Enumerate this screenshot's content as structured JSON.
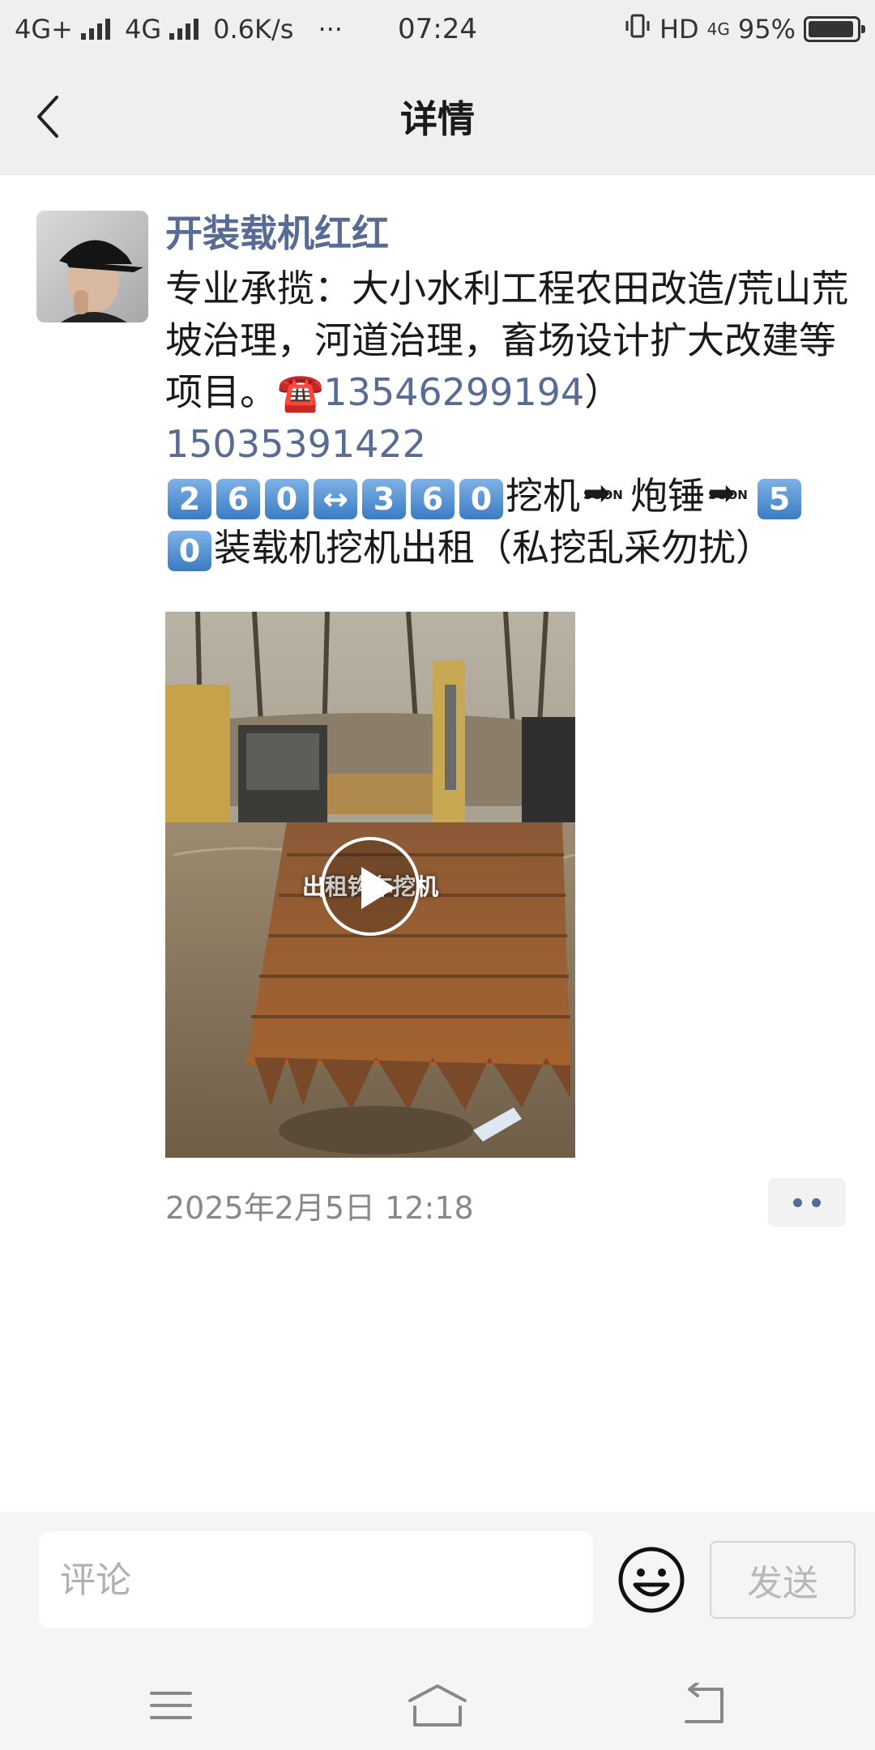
{
  "status_bar": {
    "network_left": "4G+",
    "network_mid": "4G",
    "speed": "0.6K/s",
    "dots": "···",
    "time": "07:24",
    "hd": "HD",
    "net_right": "4G",
    "battery": "95%",
    "battery_level": 0.95
  },
  "header": {
    "title": "详情",
    "back_icon": "chevron-left-icon"
  },
  "post": {
    "author": "开装载机红红",
    "text_line1": "专业承揽：大小水利工程农田改造/荒山荒坡治理，河道治理，畜场设计扩大改建等项目。",
    "phone_icon": "☎️",
    "phone1": "13546299194",
    "paren": "）",
    "phone2": "15035391422",
    "keycaps_a": [
      "2",
      "6",
      "0"
    ],
    "range_arrow": "↔",
    "keycaps_b": [
      "3",
      "6",
      "0"
    ],
    "word_excavator": "挖机",
    "soon_label": "SOON",
    "word_breaker": "炮锤",
    "keycaps_c": [
      "5",
      "0"
    ],
    "tail": "装载机挖机出租（私挖乱采勿扰）",
    "video_caption": "出租钩车挖机",
    "timestamp": "2025年2月5日 12:18"
  },
  "comment": {
    "placeholder": "评论",
    "send_label": "发送",
    "emoji_icon": "smiley-icon"
  },
  "nav": {
    "menu_icon": "menu-icon",
    "home_icon": "home-icon",
    "back_icon": "back-arrow-icon"
  }
}
